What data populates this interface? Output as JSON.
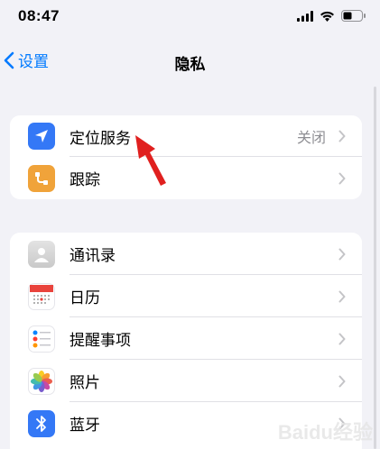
{
  "status_bar": {
    "time": "08:47"
  },
  "nav": {
    "back_label": "设置",
    "title": "隐私"
  },
  "group1": [
    {
      "label": "定位服务",
      "value": "关闭",
      "icon": "location-arrow-icon",
      "color": "#3478f6"
    },
    {
      "label": "跟踪",
      "value": "",
      "icon": "tracking-icon",
      "color": "#f0a33a"
    }
  ],
  "group2": [
    {
      "label": "通讯录",
      "icon": "contacts-icon",
      "color": "#d9d9d9"
    },
    {
      "label": "日历",
      "icon": "calendar-icon",
      "color": "#ffffff"
    },
    {
      "label": "提醒事项",
      "icon": "reminders-icon",
      "color": "#ffffff"
    },
    {
      "label": "照片",
      "icon": "photos-icon",
      "color": "#ffffff"
    },
    {
      "label": "蓝牙",
      "icon": "bluetooth-icon",
      "color": "#3478f6"
    }
  ],
  "annotation": {
    "color": "#e0201f"
  },
  "watermark": {
    "text": "Baidu经验"
  }
}
